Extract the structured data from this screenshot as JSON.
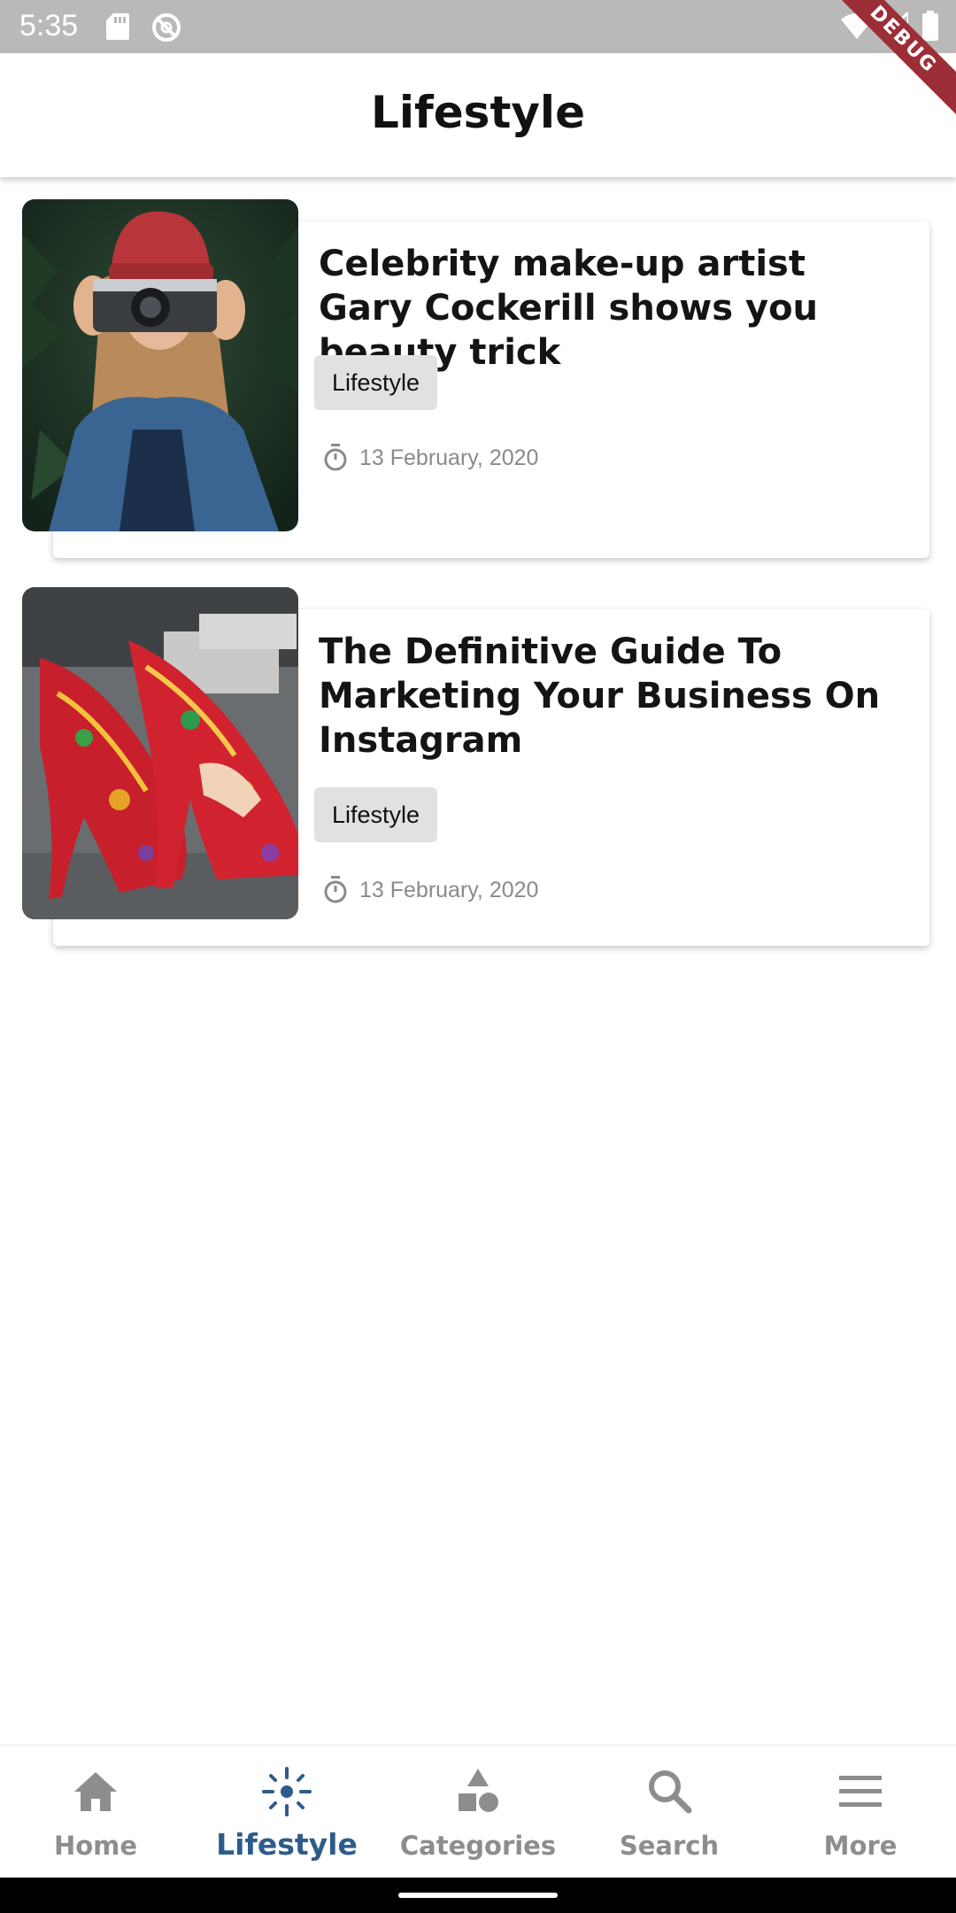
{
  "status_bar": {
    "time": "5:35"
  },
  "debug_banner": "DEBUG",
  "app_bar": {
    "title": "Lifestyle"
  },
  "articles": [
    {
      "title": "Celebrity make-up artist Gary Cockerill shows you beauty trick",
      "tag": "Lifestyle",
      "date": "13 February, 2020",
      "image": "woman-with-camera-photo"
    },
    {
      "title": "The Definitive Guide To Marketing Your Business On Instagram",
      "tag": "Lifestyle",
      "date": "13 February, 2020",
      "image": "floral-high-heels-photo"
    }
  ],
  "bottom_nav": {
    "items": [
      {
        "label": "Home",
        "icon": "home-icon",
        "active": false
      },
      {
        "label": "Lifestyle",
        "icon": "sun-icon",
        "active": true
      },
      {
        "label": "Categories",
        "icon": "shapes-icon",
        "active": false
      },
      {
        "label": "Search",
        "icon": "search-icon",
        "active": false
      },
      {
        "label": "More",
        "icon": "menu-icon",
        "active": false
      }
    ]
  },
  "colors": {
    "accent": "#2e5c8a",
    "inactive": "#8d8d8d",
    "status_bar": "#b9b9b9",
    "debug": "#9b2e36"
  }
}
